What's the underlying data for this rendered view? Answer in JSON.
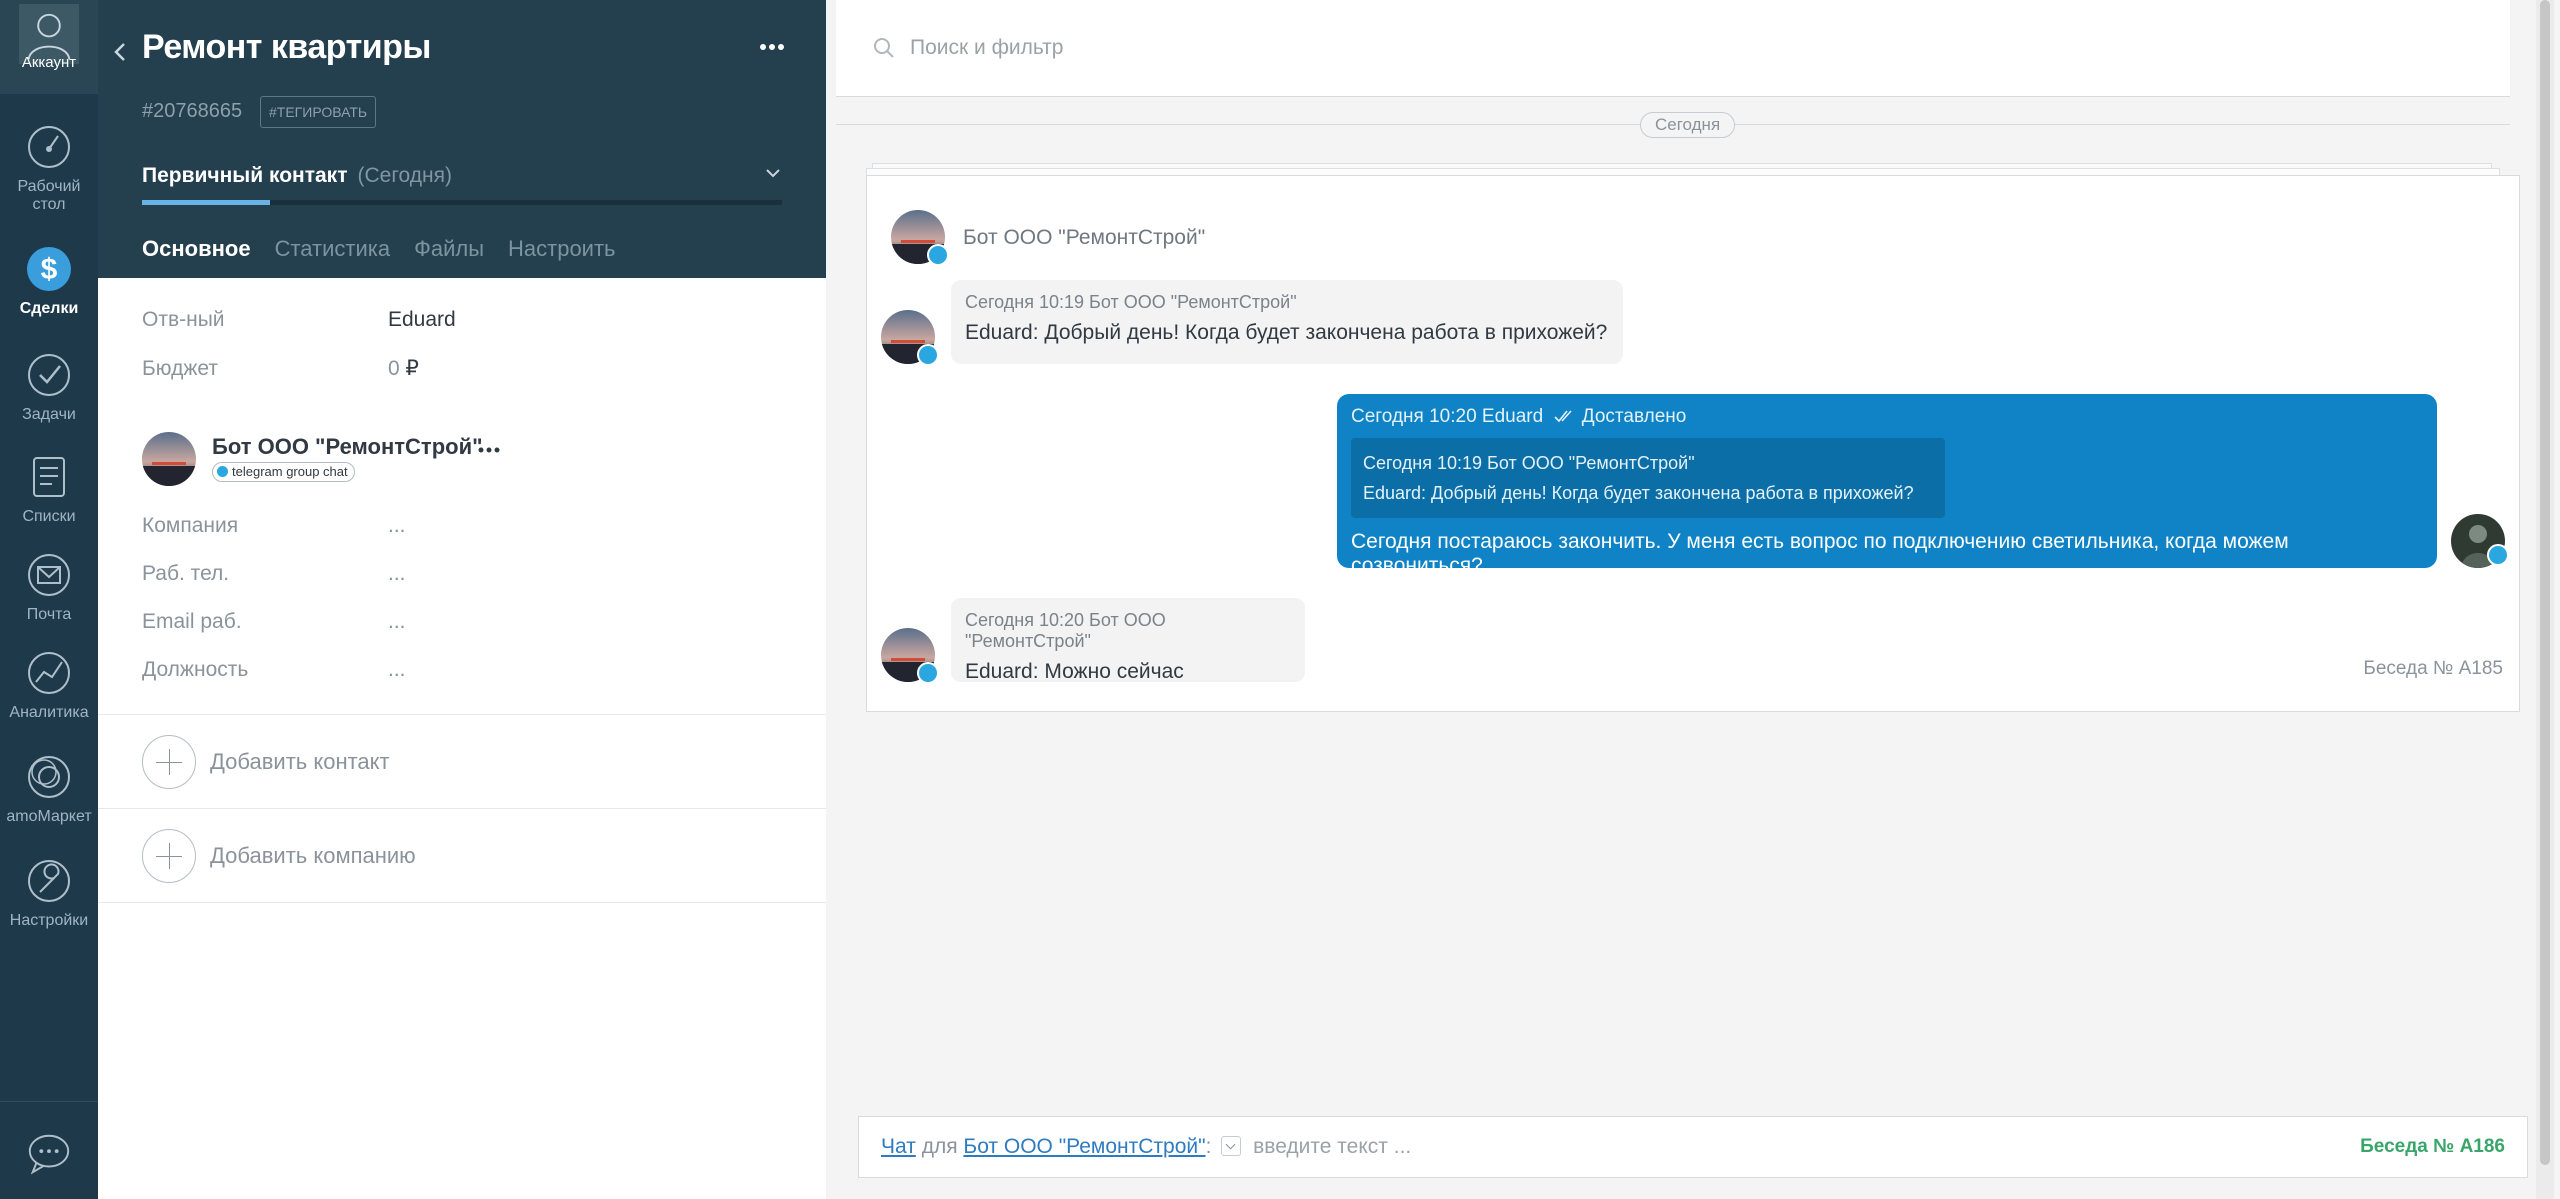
{
  "nav": {
    "items": [
      {
        "label": "Аккаунт",
        "icon": "account-icon"
      },
      {
        "label": "Рабочий стол",
        "icon": "dashboard-icon"
      },
      {
        "label": "Сделки",
        "icon": "deals-icon"
      },
      {
        "label": "Задачи",
        "icon": "tasks-icon"
      },
      {
        "label": "Списки",
        "icon": "lists-icon"
      },
      {
        "label": "Почта",
        "icon": "mail-icon"
      },
      {
        "label": "Аналитика",
        "icon": "analytics-icon"
      },
      {
        "label": "amoМаркет",
        "icon": "market-icon"
      },
      {
        "label": "Настройки",
        "icon": "settings-icon"
      }
    ],
    "active": "Сделки",
    "bottom_icon": "chat-bubble-icon"
  },
  "card": {
    "title": "Ремонт квартиры",
    "deal_id": "#20768665",
    "tag_button": "#ТЕГИРОВАТЬ",
    "stage": "Первичный контакт",
    "stage_date": "(Сегодня)",
    "stage_progress": 0.2,
    "tabs": [
      "Основное",
      "Статистика",
      "Файлы",
      "Настроить"
    ],
    "fields": [
      {
        "label": "Отв-ный",
        "value": "Eduard"
      },
      {
        "label": "Бюджет",
        "value": "₽",
        "value_prefix": "0"
      }
    ],
    "contact": {
      "name": "Бот ООО \"РемонтСтрой\"",
      "badge": "telegram group chat",
      "fields": [
        {
          "label": "Компания",
          "value": "..."
        },
        {
          "label": "Раб. тел.",
          "value": "..."
        },
        {
          "label": "Email раб.",
          "value": "..."
        },
        {
          "label": "Должность",
          "value": "..."
        }
      ]
    },
    "add_contact": "Добавить контакт",
    "add_company": "Добавить компанию"
  },
  "feed": {
    "search_placeholder": "Поиск и фильтр",
    "date_separator": "Сегодня",
    "chat_title": "Бот ООО \"РемонтСтрой\"",
    "messages": [
      {
        "meta": "Сегодня 10:19 Бот ООО \"РемонтСтрой\"",
        "text": "Eduard: Добрый день! Когда будет закончена работа в прихожей?"
      },
      {
        "meta": "Сегодня 10:20 Eduard",
        "status": "Доставлено",
        "quote_meta": "Сегодня 10:19 Бот ООО \"РемонтСтрой\"",
        "quote_text": "Eduard: Добрый день! Когда будет закончена работа в прихожей?",
        "text": "Сегодня постараюсь закончить. У меня есть вопрос по подключению светильника, когда можем созвониться?"
      },
      {
        "meta": "Сегодня 10:20 Бот ООО \"РемонтСтрой\"",
        "text": "Eduard: Можно сейчас"
      }
    ],
    "conversation_label": "Беседа № А185"
  },
  "composer": {
    "chat_word": "Чат",
    "for_word": "для",
    "recipient": "Бот ООО \"РемонтСтрой\"",
    "colon": ":",
    "placeholder": "введите текст ...",
    "next_conversation": "Беседа № А186"
  }
}
